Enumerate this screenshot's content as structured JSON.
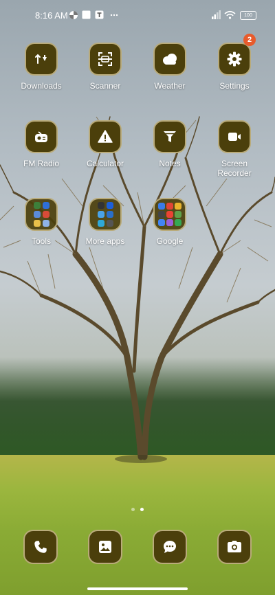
{
  "status_bar": {
    "time": "8:16 AM",
    "battery": "100",
    "left_icons": [
      "pinwheel-icon",
      "square-notification-icon",
      "t-notification-icon",
      "more-dots-icon"
    ],
    "right_icons": [
      "signal-icon",
      "wifi-icon",
      "battery-icon"
    ]
  },
  "home": {
    "apps": [
      {
        "label": "Downloads",
        "icon": "downloads-icon"
      },
      {
        "label": "Scanner",
        "icon": "scanner-icon"
      },
      {
        "label": "Weather",
        "icon": "cloud-icon"
      },
      {
        "label": "Settings",
        "icon": "gear-icon",
        "badge": "2"
      },
      {
        "label": "FM Radio",
        "icon": "radio-icon"
      },
      {
        "label": "Calculator",
        "icon": "warning-icon"
      },
      {
        "label": "Notes",
        "icon": "funnel-icon"
      },
      {
        "label": "Screen\nRecorder",
        "icon": "video-camera-icon"
      }
    ],
    "folders": [
      {
        "label": "Tools",
        "mini_colors": [
          "#3d7f3a",
          "#2f6fd6",
          "#5b8bd9",
          "#d94b38",
          "#e8c04a",
          "#8fb3e8"
        ]
      },
      {
        "label": "More apps",
        "mini_colors": [
          "#333333",
          "#1c5fd9",
          "#4aa3e8",
          "#2a6fc9",
          "#2fa8d8",
          "#555555"
        ]
      },
      {
        "label": "Google",
        "mini_colors": [
          "#3a7be8",
          "#e04436",
          "#e8b32c",
          "#444444",
          "#ea4335",
          "#5fa14a",
          "#4285f4",
          "#9a5fd8",
          "#34a853"
        ]
      }
    ]
  },
  "page_indicator": {
    "count": 2,
    "active": 1
  },
  "dock": {
    "apps": [
      {
        "name": "phone",
        "icon": "phone-icon"
      },
      {
        "name": "gallery",
        "icon": "gallery-icon"
      },
      {
        "name": "messages",
        "icon": "message-icon"
      },
      {
        "name": "camera",
        "icon": "camera-icon"
      }
    ]
  },
  "colors": {
    "icon_bg": "#4b3f0b",
    "icon_border": "#b9ab7a",
    "badge": "#e85b2c"
  }
}
